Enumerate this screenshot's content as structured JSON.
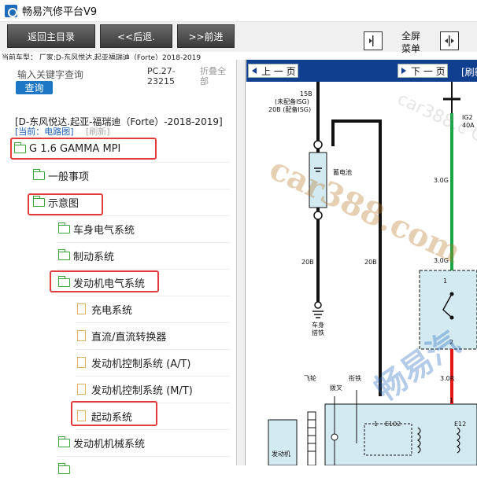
{
  "window": {
    "title": "畅易汽修平台V9",
    "icon": "app-logo-icon"
  },
  "toolbar": {
    "home_label": "返回主目录",
    "back_label": "<<后退.",
    "forward_label": ">>前进",
    "fullscreen_label": "全屏",
    "menu_label": "菜单"
  },
  "current_car": "当前车型：  厂家:D-东风悦达.起亚福瑞迪（Forte）2018-2019",
  "search": {
    "label": "输入关键字查询",
    "button": "查询"
  },
  "pc_code": "PC.27-23215",
  "collapse_all": "折叠全部",
  "car_path": "[D-东风悦达.起亚-福瑞迪（Forte）-2018-2019]",
  "current_diagram_link": "[当前：电路图]",
  "refresh_link": "[刷新]",
  "tree": [
    {
      "label": "G 1.6 GAMMA MPI",
      "type": "folder",
      "highlighted": true
    },
    {
      "label": "一般事项",
      "type": "folder",
      "highlighted": false
    },
    {
      "label": "示意图",
      "type": "folder",
      "highlighted": true
    },
    {
      "label": "车身电气系统",
      "type": "folder",
      "highlighted": false
    },
    {
      "label": "制动系统",
      "type": "folder",
      "highlighted": false
    },
    {
      "label": "发动机电气系统",
      "type": "folder",
      "highlighted": true
    },
    {
      "label": "充电系统",
      "type": "document",
      "highlighted": false
    },
    {
      "label": "直流/直流转换器",
      "type": "document",
      "highlighted": false
    },
    {
      "label": "发动机控制系统 (A/T)",
      "type": "document",
      "highlighted": false
    },
    {
      "label": "发动机控制系统 (M/T)",
      "type": "document",
      "highlighted": false
    },
    {
      "label": "起动系统",
      "type": "document",
      "highlighted": true
    },
    {
      "label": "发动机机械系统",
      "type": "folder",
      "highlighted": false
    }
  ],
  "viewer": {
    "prev_label": "上 一 页",
    "next_label": "下 一 页",
    "refresh_label": "[刷新"
  },
  "diagram_labels": {
    "wire_15b": "15B",
    "no_isg": "(未配备ISG)",
    "wire_20b_isg": "20B (配备ISG)",
    "battery": "蓄电池",
    "wire_20b_a": "20B",
    "wire_20b_b": "20B",
    "body_ground": "车身\n搭铁",
    "flywheel": "飞轮",
    "shift_fork": "拨叉",
    "iron_core": "衔铁",
    "starter": "发动机",
    "fuse_ig2": "IG2",
    "fuse_40a": "40A",
    "wire_3g_a": "3.0G",
    "wire_3g_b": "3.0G",
    "wire_3or": "3.0R",
    "conn_e102": "E102",
    "conn_e12": "E12",
    "pin_1a": "1",
    "pin_1b": "1",
    "pin_2": "2",
    "pin_1c": "1"
  },
  "watermarks": [
    "car388.com",
    "畅易汽",
    "car388.c CY201"
  ],
  "colors": {
    "nav_blue": "#0f3f8e",
    "highlight_red": "#e23b3b",
    "folder_green": "#3aa63a",
    "wire_green": "#1aa646",
    "wire_red": "#e21818",
    "panel_cyan": "#d4eaf1"
  }
}
